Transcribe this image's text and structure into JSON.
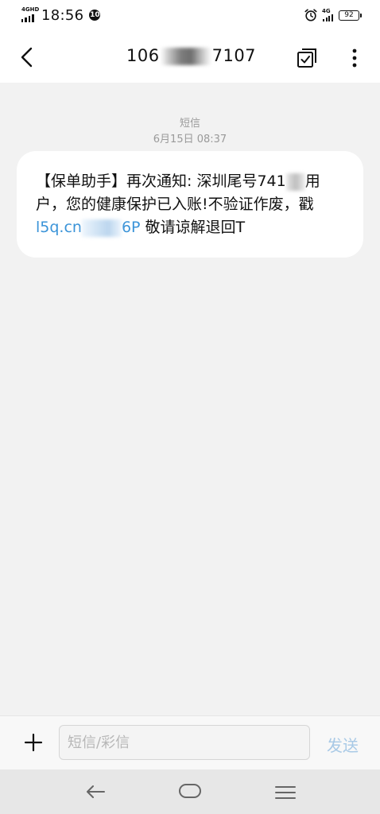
{
  "status_bar": {
    "signal_label": "4GHD",
    "time": "18:56",
    "notification_count": "10",
    "network_label": "4G",
    "battery_level": "92",
    "icons": [
      "signal-icon",
      "notification-badge",
      "alarm-icon",
      "mobile-data-icon",
      "battery-icon"
    ]
  },
  "header": {
    "title_prefix": "106",
    "title_suffix": "7107",
    "icons": [
      "back-arrow-icon",
      "multi-select-icon",
      "more-vertical-icon"
    ]
  },
  "thread": {
    "message_type": "短信",
    "date": "6月15日 08:37",
    "message": {
      "line1": "【保单助手】再次通知: 深圳尾号741",
      "line1_tail": "用",
      "line2": "户，您的健康保护已入账!不验证作废，戳",
      "link_prefix": "l5q.cn",
      "link_suffix": "6P",
      "line3_rest": " 敬请谅解退回T"
    }
  },
  "composer": {
    "placeholder": "短信/彩信",
    "send_label": "发送",
    "icons": [
      "add-icon"
    ]
  },
  "nav_bar": {
    "icons": [
      "nav-back-icon",
      "nav-home-icon",
      "nav-menu-icon"
    ]
  },
  "colors": {
    "background": "#f2f2f2",
    "bubble": "#ffffff",
    "link": "#3a93d8",
    "send_disabled": "#a8c9e6",
    "meta_text": "#9a9a9a"
  }
}
